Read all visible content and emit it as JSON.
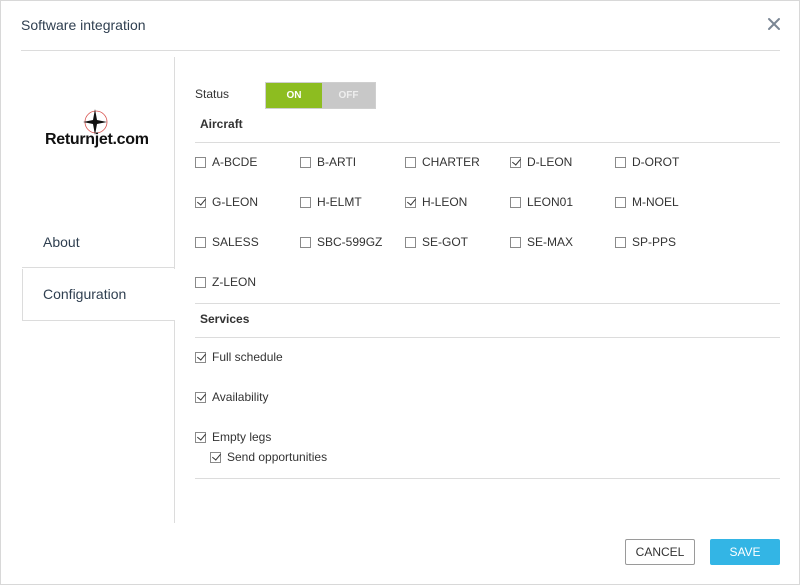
{
  "dialog": {
    "title": "Software integration",
    "close_icon": "close-icon"
  },
  "sidebar": {
    "logo_text": "Returnjet.com",
    "items": [
      {
        "label": "About",
        "active": false
      },
      {
        "label": "Configuration",
        "active": true
      }
    ]
  },
  "status": {
    "label": "Status",
    "on_label": "ON",
    "off_label": "OFF",
    "value": "ON"
  },
  "aircraft": {
    "title": "Aircraft",
    "items": [
      {
        "label": "A-BCDE",
        "checked": false
      },
      {
        "label": "B-ARTI",
        "checked": false
      },
      {
        "label": "CHARTER",
        "checked": false
      },
      {
        "label": "D-LEON",
        "checked": true
      },
      {
        "label": "D-OROT",
        "checked": false
      },
      {
        "label": "G-LEON",
        "checked": true
      },
      {
        "label": "H-ELMT",
        "checked": false
      },
      {
        "label": "H-LEON",
        "checked": true
      },
      {
        "label": "LEON01",
        "checked": false
      },
      {
        "label": "M-NOEL",
        "checked": false
      },
      {
        "label": "SALESS",
        "checked": false
      },
      {
        "label": "SBC-599GZ",
        "checked": false
      },
      {
        "label": "SE-GOT",
        "checked": false
      },
      {
        "label": "SE-MAX",
        "checked": false
      },
      {
        "label": "SP-PPS",
        "checked": false
      },
      {
        "label": "Z-LEON",
        "checked": false
      }
    ]
  },
  "services": {
    "title": "Services",
    "items": [
      {
        "label": "Full schedule",
        "checked": true
      },
      {
        "label": "Availability",
        "checked": true
      },
      {
        "label": "Empty legs",
        "checked": true
      },
      {
        "label": "Send opportunities",
        "checked": true
      }
    ]
  },
  "footer": {
    "cancel_label": "CANCEL",
    "save_label": "SAVE"
  },
  "colors": {
    "toggle_on": "#8dbd20",
    "toggle_off": "#c8c8c8",
    "save_button": "#33b5e5"
  }
}
